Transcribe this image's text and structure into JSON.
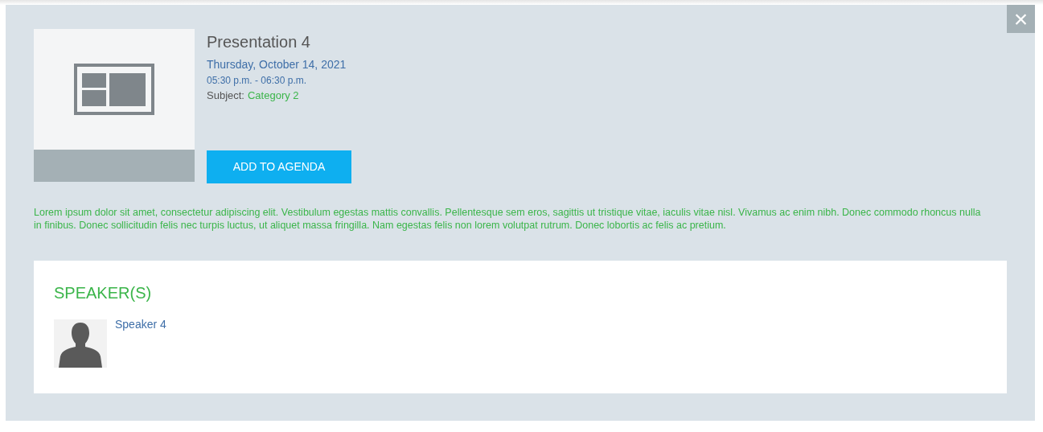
{
  "close_button": {
    "label": "×"
  },
  "session": {
    "title": "Presentation 4",
    "date": "Thursday, October 14, 2021",
    "time": "05:30 p.m. - 06:30 p.m.",
    "subject_label": "Subject:",
    "subject": "Category 2",
    "button": "ADD TO AGENDA"
  },
  "description": "Lorem ipsum dolor sit amet, consectetur adipiscing elit. Vestibulum egestas mattis convallis. Pellentesque sem eros, sagittis ut tristique vitae, iaculis vitae nisl. Vivamus ac enim nibh. Donec commodo rhoncus nulla in finibus. Donec sollicitudin felis nec turpis luctus, ut aliquet massa fringilla. Nam egestas felis non lorem volutpat rutrum. Donec lobortis ac felis ac pretium.",
  "speakers": {
    "heading": "SPEAKER(S)",
    "items": [
      {
        "name": "Speaker 4"
      }
    ]
  }
}
